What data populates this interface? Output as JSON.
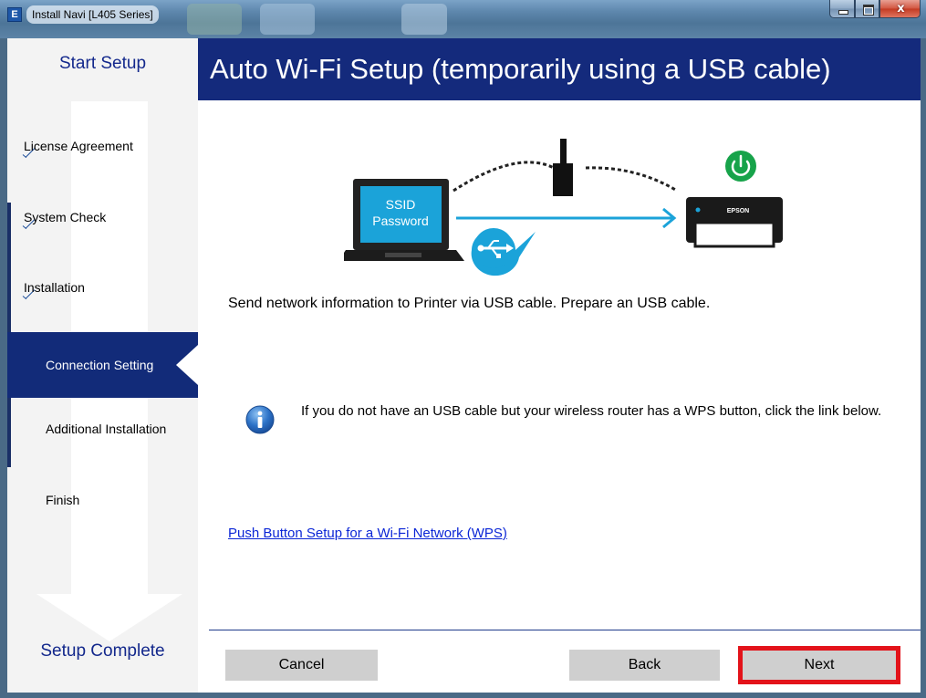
{
  "window": {
    "title": "Install Navi [L405 Series]",
    "app_icon_glyph": "E",
    "controls": {
      "close_glyph": "x"
    }
  },
  "sidebar": {
    "header": "Start Setup",
    "steps": [
      {
        "label": "License Agreement",
        "state": "done"
      },
      {
        "label": "System Check",
        "state": "done"
      },
      {
        "label": "Installation",
        "state": "done"
      },
      {
        "label": "Connection Setting",
        "state": "active"
      },
      {
        "label": "Additional Installation",
        "state": "pending"
      },
      {
        "label": "Finish",
        "state": "pending"
      }
    ],
    "footer": "Setup Complete"
  },
  "main": {
    "title": "Auto Wi-Fi Setup (temporarily using a USB cable)",
    "illustration": {
      "laptop_screen_lines": [
        "SSID",
        "Password"
      ],
      "printer_brand": "EPSON"
    },
    "instruction": "Send network information to Printer via USB cable. Prepare an USB cable.",
    "info_text": "If you do not have an USB cable but your wireless router has a WPS button, click the link below.",
    "wps_link": "Push Button Setup for a Wi-Fi Network (WPS)"
  },
  "buttons": {
    "cancel": "Cancel",
    "back": "Back",
    "next": "Next"
  },
  "colors": {
    "header_blue": "#142a7c",
    "active_step_blue": "#122b79",
    "accent_cyan": "#1ba3d9",
    "power_green": "#17a34a",
    "link_blue": "#0b26d6",
    "next_highlight": "#e3131a"
  }
}
